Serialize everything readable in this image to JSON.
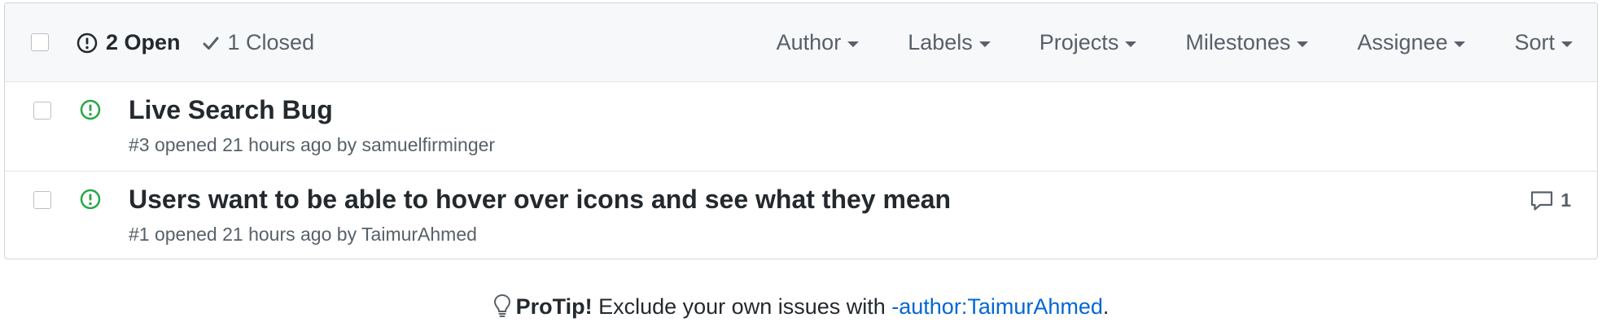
{
  "header": {
    "open_label": "2 Open",
    "closed_label": "1 Closed",
    "filters": [
      "Author",
      "Labels",
      "Projects",
      "Milestones",
      "Assignee",
      "Sort"
    ]
  },
  "issues": [
    {
      "title": "Live Search Bug",
      "meta": "#3 opened 21 hours ago by samuelfirminger",
      "comments": ""
    },
    {
      "title": "Users want to be able to hover over icons and see what they mean",
      "meta": "#1 opened 21 hours ago by TaimurAhmed",
      "comments": "1"
    }
  ],
  "protip": {
    "label": "ProTip!",
    "text": " Exclude your own issues with ",
    "link": "-author:TaimurAhmed",
    "suffix": "."
  },
  "colors": {
    "open_green": "#28a745",
    "link_blue": "#0366d6",
    "border": "#d1d5da"
  },
  "icons": {
    "open": "issue-opened-icon",
    "closed": "check-icon",
    "comment": "comment-icon",
    "tip": "light-bulb-icon"
  }
}
